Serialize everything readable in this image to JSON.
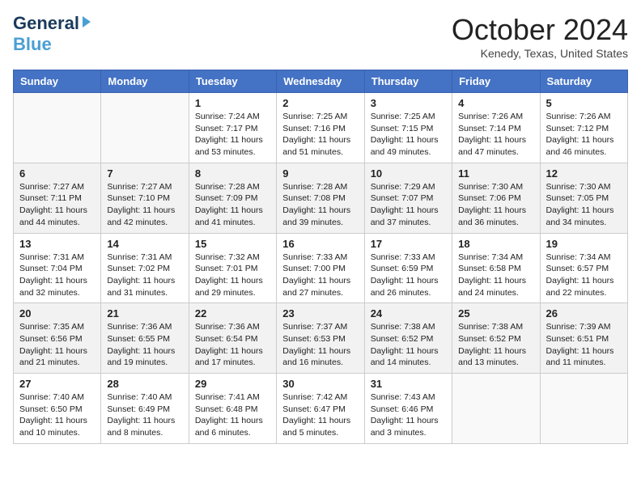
{
  "header": {
    "logo_general": "General",
    "logo_blue": "Blue",
    "month_title": "October 2024",
    "location": "Kenedy, Texas, United States"
  },
  "days_of_week": [
    "Sunday",
    "Monday",
    "Tuesday",
    "Wednesday",
    "Thursday",
    "Friday",
    "Saturday"
  ],
  "weeks": [
    [
      {
        "day": "",
        "sunrise": "",
        "sunset": "",
        "daylight": ""
      },
      {
        "day": "",
        "sunrise": "",
        "sunset": "",
        "daylight": ""
      },
      {
        "day": "1",
        "sunrise": "Sunrise: 7:24 AM",
        "sunset": "Sunset: 7:17 PM",
        "daylight": "Daylight: 11 hours and 53 minutes."
      },
      {
        "day": "2",
        "sunrise": "Sunrise: 7:25 AM",
        "sunset": "Sunset: 7:16 PM",
        "daylight": "Daylight: 11 hours and 51 minutes."
      },
      {
        "day": "3",
        "sunrise": "Sunrise: 7:25 AM",
        "sunset": "Sunset: 7:15 PM",
        "daylight": "Daylight: 11 hours and 49 minutes."
      },
      {
        "day": "4",
        "sunrise": "Sunrise: 7:26 AM",
        "sunset": "Sunset: 7:14 PM",
        "daylight": "Daylight: 11 hours and 47 minutes."
      },
      {
        "day": "5",
        "sunrise": "Sunrise: 7:26 AM",
        "sunset": "Sunset: 7:12 PM",
        "daylight": "Daylight: 11 hours and 46 minutes."
      }
    ],
    [
      {
        "day": "6",
        "sunrise": "Sunrise: 7:27 AM",
        "sunset": "Sunset: 7:11 PM",
        "daylight": "Daylight: 11 hours and 44 minutes."
      },
      {
        "day": "7",
        "sunrise": "Sunrise: 7:27 AM",
        "sunset": "Sunset: 7:10 PM",
        "daylight": "Daylight: 11 hours and 42 minutes."
      },
      {
        "day": "8",
        "sunrise": "Sunrise: 7:28 AM",
        "sunset": "Sunset: 7:09 PM",
        "daylight": "Daylight: 11 hours and 41 minutes."
      },
      {
        "day": "9",
        "sunrise": "Sunrise: 7:28 AM",
        "sunset": "Sunset: 7:08 PM",
        "daylight": "Daylight: 11 hours and 39 minutes."
      },
      {
        "day": "10",
        "sunrise": "Sunrise: 7:29 AM",
        "sunset": "Sunset: 7:07 PM",
        "daylight": "Daylight: 11 hours and 37 minutes."
      },
      {
        "day": "11",
        "sunrise": "Sunrise: 7:30 AM",
        "sunset": "Sunset: 7:06 PM",
        "daylight": "Daylight: 11 hours and 36 minutes."
      },
      {
        "day": "12",
        "sunrise": "Sunrise: 7:30 AM",
        "sunset": "Sunset: 7:05 PM",
        "daylight": "Daylight: 11 hours and 34 minutes."
      }
    ],
    [
      {
        "day": "13",
        "sunrise": "Sunrise: 7:31 AM",
        "sunset": "Sunset: 7:04 PM",
        "daylight": "Daylight: 11 hours and 32 minutes."
      },
      {
        "day": "14",
        "sunrise": "Sunrise: 7:31 AM",
        "sunset": "Sunset: 7:02 PM",
        "daylight": "Daylight: 11 hours and 31 minutes."
      },
      {
        "day": "15",
        "sunrise": "Sunrise: 7:32 AM",
        "sunset": "Sunset: 7:01 PM",
        "daylight": "Daylight: 11 hours and 29 minutes."
      },
      {
        "day": "16",
        "sunrise": "Sunrise: 7:33 AM",
        "sunset": "Sunset: 7:00 PM",
        "daylight": "Daylight: 11 hours and 27 minutes."
      },
      {
        "day": "17",
        "sunrise": "Sunrise: 7:33 AM",
        "sunset": "Sunset: 6:59 PM",
        "daylight": "Daylight: 11 hours and 26 minutes."
      },
      {
        "day": "18",
        "sunrise": "Sunrise: 7:34 AM",
        "sunset": "Sunset: 6:58 PM",
        "daylight": "Daylight: 11 hours and 24 minutes."
      },
      {
        "day": "19",
        "sunrise": "Sunrise: 7:34 AM",
        "sunset": "Sunset: 6:57 PM",
        "daylight": "Daylight: 11 hours and 22 minutes."
      }
    ],
    [
      {
        "day": "20",
        "sunrise": "Sunrise: 7:35 AM",
        "sunset": "Sunset: 6:56 PM",
        "daylight": "Daylight: 11 hours and 21 minutes."
      },
      {
        "day": "21",
        "sunrise": "Sunrise: 7:36 AM",
        "sunset": "Sunset: 6:55 PM",
        "daylight": "Daylight: 11 hours and 19 minutes."
      },
      {
        "day": "22",
        "sunrise": "Sunrise: 7:36 AM",
        "sunset": "Sunset: 6:54 PM",
        "daylight": "Daylight: 11 hours and 17 minutes."
      },
      {
        "day": "23",
        "sunrise": "Sunrise: 7:37 AM",
        "sunset": "Sunset: 6:53 PM",
        "daylight": "Daylight: 11 hours and 16 minutes."
      },
      {
        "day": "24",
        "sunrise": "Sunrise: 7:38 AM",
        "sunset": "Sunset: 6:52 PM",
        "daylight": "Daylight: 11 hours and 14 minutes."
      },
      {
        "day": "25",
        "sunrise": "Sunrise: 7:38 AM",
        "sunset": "Sunset: 6:52 PM",
        "daylight": "Daylight: 11 hours and 13 minutes."
      },
      {
        "day": "26",
        "sunrise": "Sunrise: 7:39 AM",
        "sunset": "Sunset: 6:51 PM",
        "daylight": "Daylight: 11 hours and 11 minutes."
      }
    ],
    [
      {
        "day": "27",
        "sunrise": "Sunrise: 7:40 AM",
        "sunset": "Sunset: 6:50 PM",
        "daylight": "Daylight: 11 hours and 10 minutes."
      },
      {
        "day": "28",
        "sunrise": "Sunrise: 7:40 AM",
        "sunset": "Sunset: 6:49 PM",
        "daylight": "Daylight: 11 hours and 8 minutes."
      },
      {
        "day": "29",
        "sunrise": "Sunrise: 7:41 AM",
        "sunset": "Sunset: 6:48 PM",
        "daylight": "Daylight: 11 hours and 6 minutes."
      },
      {
        "day": "30",
        "sunrise": "Sunrise: 7:42 AM",
        "sunset": "Sunset: 6:47 PM",
        "daylight": "Daylight: 11 hours and 5 minutes."
      },
      {
        "day": "31",
        "sunrise": "Sunrise: 7:43 AM",
        "sunset": "Sunset: 6:46 PM",
        "daylight": "Daylight: 11 hours and 3 minutes."
      },
      {
        "day": "",
        "sunrise": "",
        "sunset": "",
        "daylight": ""
      },
      {
        "day": "",
        "sunrise": "",
        "sunset": "",
        "daylight": ""
      }
    ]
  ]
}
